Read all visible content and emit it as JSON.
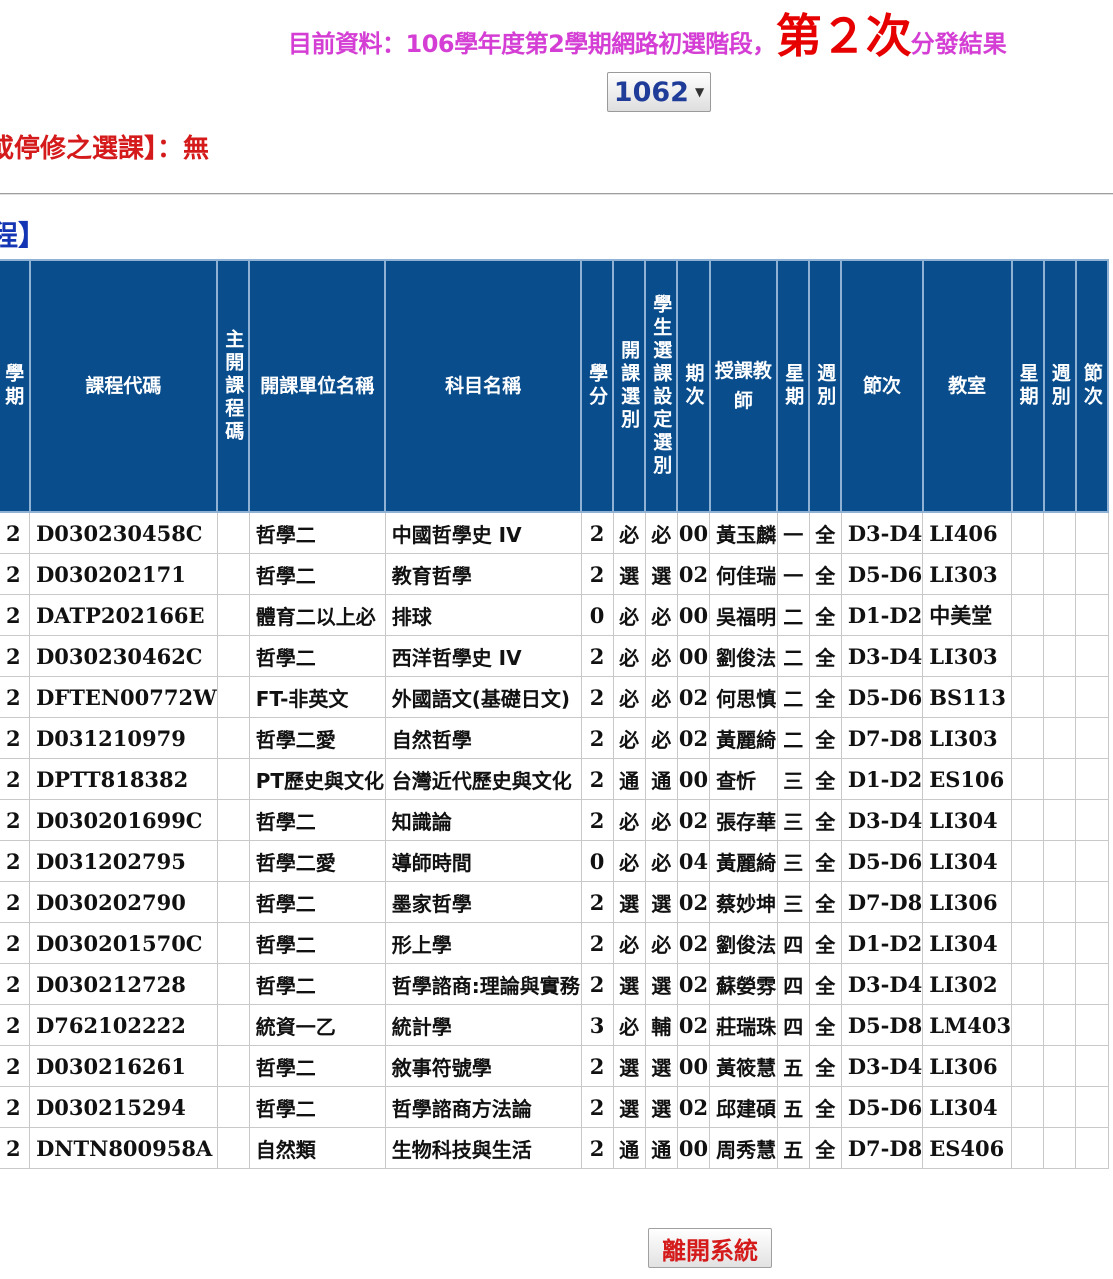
{
  "header": {
    "prefix": "目前資料：106學年度第2學期網路初選階段，",
    "round": "第２次",
    "suffix": "分發結果"
  },
  "semester_select": {
    "selected": "1062"
  },
  "suspend_notice": "或停修之選課】：無",
  "section_title": "程】",
  "table": {
    "headers": [
      "學期",
      "課程代碼",
      "主開課程碼",
      "開課單位名稱",
      "科目名稱",
      "學分",
      "開課選別",
      "學生選課設定選別",
      "期次",
      "授課教師",
      "星期",
      "週別",
      "節次",
      "教室",
      "星期",
      "週別",
      "節次"
    ],
    "rows": [
      [
        "2",
        "D030230458C",
        "",
        "哲學二",
        "中國哲學史 IV",
        "2",
        "必",
        "必",
        "00",
        "黃玉麟",
        "一",
        "全",
        "D3-D4",
        "LI406"
      ],
      [
        "2",
        "D030202171",
        "",
        "哲學二",
        "教育哲學",
        "2",
        "選",
        "選",
        "02",
        "何佳瑞",
        "一",
        "全",
        "D5-D6",
        "LI303"
      ],
      [
        "2",
        "DATP202166E",
        "",
        "體育二以上必",
        "排球",
        "0",
        "必",
        "必",
        "00",
        "吳福明",
        "二",
        "全",
        "D1-D2",
        "中美堂"
      ],
      [
        "2",
        "D030230462C",
        "",
        "哲學二",
        "西洋哲學史 IV",
        "2",
        "必",
        "必",
        "00",
        "劉俊法",
        "二",
        "全",
        "D3-D4",
        "LI303"
      ],
      [
        "2",
        "DFTEN00772W",
        "",
        "FT-非英文",
        "外國語文(基礎日文)",
        "2",
        "必",
        "必",
        "02",
        "何思慎",
        "二",
        "全",
        "D5-D6",
        "BS113"
      ],
      [
        "2",
        "D031210979",
        "",
        "哲學二愛",
        "自然哲學",
        "2",
        "必",
        "必",
        "02",
        "黃麗綺",
        "二",
        "全",
        "D7-D8",
        "LI303"
      ],
      [
        "2",
        "DPTT818382",
        "",
        "PT歷史與文化",
        "台灣近代歷史與文化",
        "2",
        "通",
        "通",
        "00",
        "查忻",
        "三",
        "全",
        "D1-D2",
        "ES106"
      ],
      [
        "2",
        "D030201699C",
        "",
        "哲學二",
        "知識論",
        "2",
        "必",
        "必",
        "02",
        "張存華",
        "三",
        "全",
        "D3-D4",
        "LI304"
      ],
      [
        "2",
        "D031202795",
        "",
        "哲學二愛",
        "導師時間",
        "0",
        "必",
        "必",
        "04",
        "黃麗綺",
        "三",
        "全",
        "D5-D6",
        "LI304"
      ],
      [
        "2",
        "D030202790",
        "",
        "哲學二",
        "墨家哲學",
        "2",
        "選",
        "選",
        "02",
        "蔡妙坤",
        "三",
        "全",
        "D7-D8",
        "LI306"
      ],
      [
        "2",
        "D030201570C",
        "",
        "哲學二",
        "形上學",
        "2",
        "必",
        "必",
        "02",
        "劉俊法",
        "四",
        "全",
        "D1-D2",
        "LI304"
      ],
      [
        "2",
        "D030212728",
        "",
        "哲學二",
        "哲學諮商:理論與實務",
        "2",
        "選",
        "選",
        "02",
        "蘇嫈雰",
        "四",
        "全",
        "D3-D4",
        "LI302"
      ],
      [
        "2",
        "D762102222",
        "",
        "統資一乙",
        "統計學",
        "3",
        "必",
        "輔",
        "02",
        "莊瑞珠",
        "四",
        "全",
        "D5-D8",
        "LM403"
      ],
      [
        "2",
        "D030216261",
        "",
        "哲學二",
        "敘事符號學",
        "2",
        "選",
        "選",
        "00",
        "黃筱慧",
        "五",
        "全",
        "D3-D4",
        "LI306"
      ],
      [
        "2",
        "D030215294",
        "",
        "哲學二",
        "哲學諮商方法論",
        "2",
        "選",
        "選",
        "02",
        "邱建碩",
        "五",
        "全",
        "D5-D6",
        "LI304"
      ],
      [
        "2",
        "DNTN800958A",
        "",
        "自然類",
        "生物科技與生活",
        "2",
        "通",
        "通",
        "00",
        "周秀慧",
        "五",
        "全",
        "D7-D8",
        "ES406"
      ]
    ]
  },
  "leave_button": "離開系統",
  "colors": {
    "header_bg": "#0a4d8c",
    "title_magenta": "#d43ed4",
    "alert_red": "#e60000",
    "link_blue": "#1436b4"
  }
}
